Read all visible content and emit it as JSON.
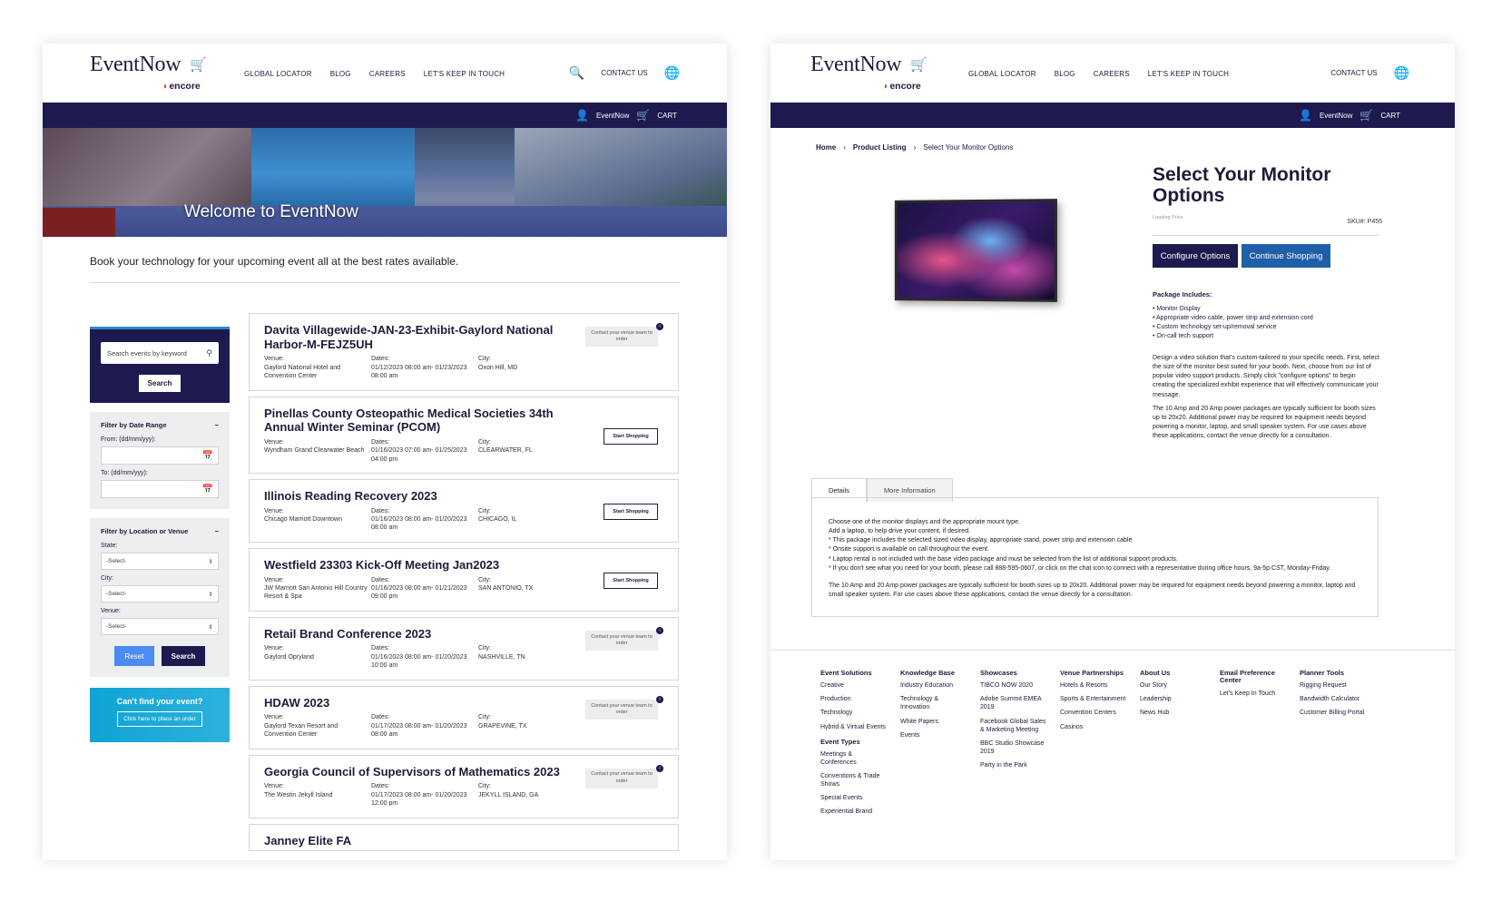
{
  "brand": {
    "name": "EventNow",
    "sub": "encore"
  },
  "nav": [
    "GLOBAL LOCATOR",
    "BLOG",
    "CAREERS",
    "LET'S KEEP IN TOUCH"
  ],
  "header": {
    "contact": "CONTACT US",
    "account": "EventNow",
    "cart": "CART"
  },
  "home": {
    "hero_title": "Welcome to EventNow",
    "intro": "Book your technology for your upcoming event all at the best rates available.",
    "search_placeholder": "Search events by keyword",
    "search_btn": "Search",
    "filter_date": "Filter by Date Range",
    "from_label": "From: (dd/mm/yyy):",
    "to_label": "To: (dd/mm/yyy):",
    "filter_loc": "Filter by Location or Venue",
    "state_label": "State:",
    "city_label": "City:",
    "venue_label": "Venue:",
    "select_text": "-Select-",
    "reset_btn": "Reset",
    "search_btn2": "Search",
    "cant_find": "Can't find your event?",
    "place_order": "Click here to place an order",
    "venue_h": "Venue:",
    "dates_h": "Dates:",
    "city_h": "City:",
    "contact_text": "Contact your venue team to order",
    "start_shopping": "Start Shopping",
    "events": [
      {
        "title": "Davita Villagewide-JAN-23-Exhibit-Gaylord National Harbor-M-FEJZ5UH",
        "venue": "Gaylord National Hotel and Convention Center",
        "dates": "01/12/2023 08:00 am- 01/23/2023 08:00 am",
        "city": "Oxon Hill, MD",
        "action": "contact"
      },
      {
        "title": "Pinellas County Osteopathic Medical Societies 34th Annual Winter Seminar (PCOM)",
        "venue": "Wyndham Grand Clearwater Beach",
        "dates": "01/16/2023 07:00 am- 01/25/2023 04:00 pm",
        "city": "CLEARWATER, FL",
        "action": "shop"
      },
      {
        "title": "Illinois Reading Recovery 2023",
        "venue": "Chicago Marriott Downtown",
        "dates": "01/16/2023 08:00 am- 01/20/2023 08:00 am",
        "city": "CHICAGO, IL",
        "action": "shop"
      },
      {
        "title": "Westfield 23303 Kick-Off Meeting Jan2023",
        "venue": "JW Marriott San Antonio Hill Country Resort & Spa",
        "dates": "01/16/2023 08:00 am- 01/21/2023 09:00 pm",
        "city": "SAN ANTONIO, TX",
        "action": "shop"
      },
      {
        "title": "Retail Brand Conference 2023",
        "venue": "Gaylord Opryland",
        "dates": "01/16/2023 08:00 am- 01/20/2023 10:00 am",
        "city": "NASHVILLE, TN",
        "action": "contact"
      },
      {
        "title": "HDAW 2023",
        "venue": "Gaylord Texan Resort and Convention Center",
        "dates": "01/17/2023 08:00 am- 01/20/2023 08:00 am",
        "city": "GRAPEVINE, TX",
        "action": "contact"
      },
      {
        "title": "Georgia Council of Supervisors of Mathematics 2023",
        "venue": "The Westin Jekyll Island",
        "dates": "01/17/2023 08:00 am- 01/20/2023 12:00 pm",
        "city": "JEKYLL ISLAND, GA",
        "action": "contact"
      },
      {
        "title": "Janney Elite FA",
        "venue": "",
        "dates": "",
        "city": "",
        "action": "shop"
      }
    ]
  },
  "product": {
    "crumbs": [
      "Home",
      "Product Listing",
      "Select Your Monitor Options"
    ],
    "title": "Select Your Monitor Options",
    "loading": "Loading Price",
    "sku": "SKU#: P455",
    "configure": "Configure Options",
    "continue": "Continue Shopping",
    "pkg_heading": "Package Includes:",
    "pkg_items": [
      "• Monitor Display",
      "• Appropriate video cable, power strip and extension cord",
      "• Custom technology set-up/removal service",
      "• On-call tech support"
    ],
    "desc1": "Design a video solution that's custom-tailored to your specific needs. First, select the size of the monitor best suited for your booth. Next, choose from our list of popular video support products. Simply click \"configure options\" to begin creating the specialized exhibit experience that will effectively communicate your message.",
    "desc2": "The 10 Amp and 20 Amp power packages are typically sufficient for booth sizes up to 20x20. Additional power may be required for equipment needs beyond powering a monitor, laptop, and small speaker system. For use cases above these applications, contact the venue directly for a consultation.",
    "tab1": "Details",
    "tab2": "More Information",
    "details": [
      "Choose one of the monitor displays and the appropriate mount type.",
      "Add a laptop, to help drive your content, if desired.",
      "* This package includes the selected sized video display, appropriate stand, power strip and extension cable",
      "* Onsite support is available on call throughout the event.",
      "* Laptop rental is not included with the base video package and must be selected from the list of additional support products.",
      "* If you don't see what you need for your booth, please call 888-595-0607, or click on the chat icon to connect with a representative during office hours, 9a-5p CST, Monday-Friday."
    ],
    "details_note": "The 10 Amp and 20 Amp power packages are typically sufficient for booth sizes up to 20x20. Additional power may be required for equipment needs beyond powering a monitor, laptop and small speaker system. For use cases above these applications, contact the venue directly for a consultation."
  },
  "footer": [
    {
      "h": "Event Solutions",
      "items": [
        "Creative",
        "Production",
        "Technology",
        "Hybrid & Virtual Events"
      ],
      "h2": "Event Types",
      "items2": [
        "Meetings & Conferences",
        "Conventions & Trade Shows",
        "Special Events",
        "Experiential Brand"
      ]
    },
    {
      "h": "Knowledge Base",
      "items": [
        "Industry Education",
        "Technology & Innovation",
        "White Papers",
        "Events"
      ]
    },
    {
      "h": "Showcases",
      "items": [
        "TIBCO NOW 2020",
        "Adobe Summit EMEA 2019",
        "Facebook Global Sales & Marketing Meeting",
        "BBC Studio Showcase 2019",
        "Party in the Park"
      ]
    },
    {
      "h": "Venue Partnerships",
      "items": [
        "Hotels & Resorts",
        "Sports & Entertainment",
        "Convention Centers",
        "Casinos"
      ]
    },
    {
      "h": "About Us",
      "items": [
        "Our Story",
        "Leadership",
        "News Hub"
      ]
    },
    {
      "h": "Email Preference Center",
      "items": [
        "Let's Keep In Touch"
      ]
    },
    {
      "h": "Planner Tools",
      "items": [
        "Rigging Request",
        "Bandwidth Calculator",
        "Customer Billing Portal"
      ]
    }
  ]
}
